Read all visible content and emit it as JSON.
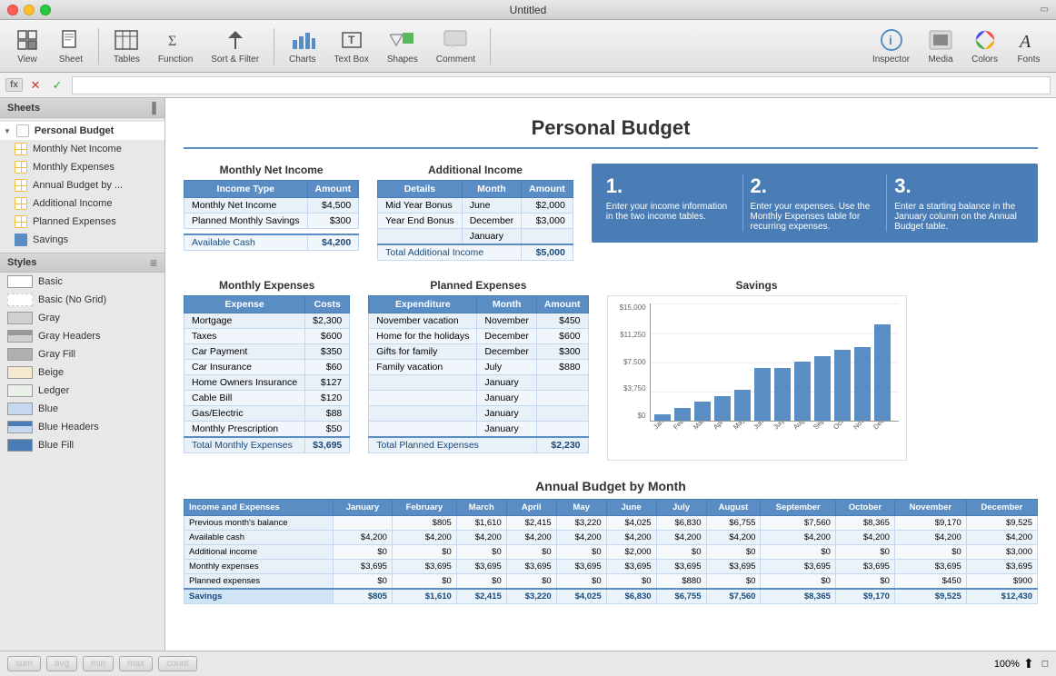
{
  "window": {
    "title": "Untitled",
    "buttons": {
      "red": "●",
      "yellow": "●",
      "green": "●"
    }
  },
  "toolbar": {
    "view_label": "View",
    "sheet_label": "Sheet",
    "tables_label": "Tables",
    "function_label": "Function",
    "sort_filter_label": "Sort & Filter",
    "charts_label": "Charts",
    "textbox_label": "Text Box",
    "shapes_label": "Shapes",
    "comment_label": "Comment",
    "inspector_label": "Inspector",
    "media_label": "Media",
    "colors_label": "Colors",
    "fonts_label": "Fonts"
  },
  "sidebar": {
    "sheets_label": "Sheets",
    "items": [
      {
        "label": "Personal Budget",
        "type": "parent",
        "active": true
      },
      {
        "label": "Monthly Net Income",
        "type": "grid"
      },
      {
        "label": "Monthly Expenses",
        "type": "grid"
      },
      {
        "label": "Annual Budget by ...",
        "type": "grid"
      },
      {
        "label": "Additional Income",
        "type": "grid"
      },
      {
        "label": "Planned Expenses",
        "type": "grid"
      },
      {
        "label": "Savings",
        "type": "bar"
      }
    ],
    "styles_label": "Styles",
    "styles": [
      {
        "label": "Basic",
        "type": "basic"
      },
      {
        "label": "Basic (No Grid)",
        "type": "basic-nogrid"
      },
      {
        "label": "Gray",
        "type": "gray"
      },
      {
        "label": "Gray Headers",
        "type": "gray-headers"
      },
      {
        "label": "Gray Fill",
        "type": "gray-fill"
      },
      {
        "label": "Beige",
        "type": "beige"
      },
      {
        "label": "Ledger",
        "type": "ledger"
      },
      {
        "label": "Blue",
        "type": "blue"
      },
      {
        "label": "Blue Headers",
        "type": "blue-headers"
      },
      {
        "label": "Blue Fill",
        "type": "blue-fill"
      }
    ]
  },
  "bottombar": {
    "sum": "sum",
    "avg": "avg",
    "min": "min",
    "max": "max",
    "count": "count",
    "zoom": "100%"
  },
  "content": {
    "title": "Personal Budget",
    "monthly_net_income": {
      "section_title": "Monthly Net Income",
      "headers": [
        "Income Type",
        "Amount"
      ],
      "rows": [
        [
          "Monthly Net Income",
          "$4,500"
        ],
        [
          "Planned Monthly Savings",
          "$300"
        ]
      ],
      "total_label": "Available Cash",
      "total_value": "$4,200"
    },
    "additional_income": {
      "section_title": "Additional Income",
      "headers": [
        "Details",
        "Month",
        "Amount"
      ],
      "rows": [
        [
          "Mid Year Bonus",
          "June",
          "$2,000"
        ],
        [
          "Year End Bonus",
          "December",
          "$3,000"
        ],
        [
          "",
          "January",
          ""
        ]
      ],
      "total_label": "Total Additional Income",
      "total_value": "$5,000"
    },
    "info_boxes": [
      {
        "num": "1.",
        "text": "Enter your income information in the two income tables."
      },
      {
        "num": "2.",
        "text": "Enter your expenses. Use the Monthly Expenses table for recurring expenses."
      },
      {
        "num": "3.",
        "text": "Enter a starting balance in the January column on the Annual Budget table."
      }
    ],
    "monthly_expenses": {
      "section_title": "Monthly Expenses",
      "headers": [
        "Expense",
        "Costs"
      ],
      "rows": [
        [
          "Mortgage",
          "$2,300"
        ],
        [
          "Taxes",
          "$600"
        ],
        [
          "Car Payment",
          "$350"
        ],
        [
          "Car Insurance",
          "$60"
        ],
        [
          "Home Owners Insurance",
          "$127"
        ],
        [
          "Cable Bill",
          "$120"
        ],
        [
          "Gas/Electric",
          "$88"
        ],
        [
          "Monthly Prescription",
          "$50"
        ]
      ],
      "total_label": "Total Monthly Expenses",
      "total_value": "$3,695"
    },
    "planned_expenses": {
      "section_title": "Planned Expenses",
      "headers": [
        "Expenditure",
        "Month",
        "Amount"
      ],
      "rows": [
        [
          "November vacation",
          "November",
          "$450"
        ],
        [
          "Home for the holidays",
          "December",
          "$600"
        ],
        [
          "Gifts for family",
          "December",
          "$300"
        ],
        [
          "Family vacation",
          "July",
          "$880"
        ],
        [
          "",
          "January",
          ""
        ],
        [
          "",
          "January",
          ""
        ],
        [
          "",
          "January",
          ""
        ],
        [
          "",
          "January",
          ""
        ]
      ],
      "total_label": "Total Planned Expenses",
      "total_value": "$2,230"
    },
    "savings": {
      "section_title": "Savings",
      "y_labels": [
        "$15,000",
        "$11,250",
        "$7,500",
        "$3,750",
        "$0"
      ],
      "months": [
        "January",
        "February",
        "March",
        "April",
        "May",
        "June",
        "July",
        "August",
        "September",
        "October",
        "November",
        "December"
      ],
      "values": [
        805,
        1610,
        2415,
        3220,
        4025,
        6830,
        6755,
        7560,
        8365,
        9170,
        9525,
        12430
      ],
      "max_val": 15000
    },
    "annual_budget": {
      "section_title": "Annual Budget by Month",
      "headers": [
        "Income and Expenses",
        "January",
        "February",
        "March",
        "April",
        "May",
        "June",
        "July",
        "August",
        "September",
        "October",
        "November",
        "December"
      ],
      "rows": [
        {
          "label": "Previous month's balance",
          "values": [
            "",
            "$805",
            "$1,610",
            "$2,415",
            "$3,220",
            "$4,025",
            "$6,830",
            "$6,755",
            "$7,560",
            "$8,365",
            "$9,170",
            "$9,525"
          ]
        },
        {
          "label": "Available cash",
          "values": [
            "$4,200",
            "$4,200",
            "$4,200",
            "$4,200",
            "$4,200",
            "$4,200",
            "$4,200",
            "$4,200",
            "$4,200",
            "$4,200",
            "$4,200",
            "$4,200"
          ]
        },
        {
          "label": "Additional income",
          "values": [
            "$0",
            "$0",
            "$0",
            "$0",
            "$0",
            "$2,000",
            "$0",
            "$0",
            "$0",
            "$0",
            "$0",
            "$3,000"
          ]
        },
        {
          "label": "Monthly expenses",
          "values": [
            "$3,695",
            "$3,695",
            "$3,695",
            "$3,695",
            "$3,695",
            "$3,695",
            "$3,695",
            "$3,695",
            "$3,695",
            "$3,695",
            "$3,695",
            "$3,695"
          ]
        },
        {
          "label": "Planned expenses",
          "values": [
            "$0",
            "$0",
            "$0",
            "$0",
            "$0",
            "$0",
            "$880",
            "$0",
            "$0",
            "$0",
            "$450",
            "$900"
          ]
        },
        {
          "label": "Savings",
          "values": [
            "$805",
            "$1,610",
            "$2,415",
            "$3,220",
            "$4,025",
            "$6,830",
            "$6,755",
            "$7,560",
            "$8,365",
            "$9,170",
            "$9,525",
            "$12,430"
          ],
          "is_total": true
        }
      ]
    }
  }
}
